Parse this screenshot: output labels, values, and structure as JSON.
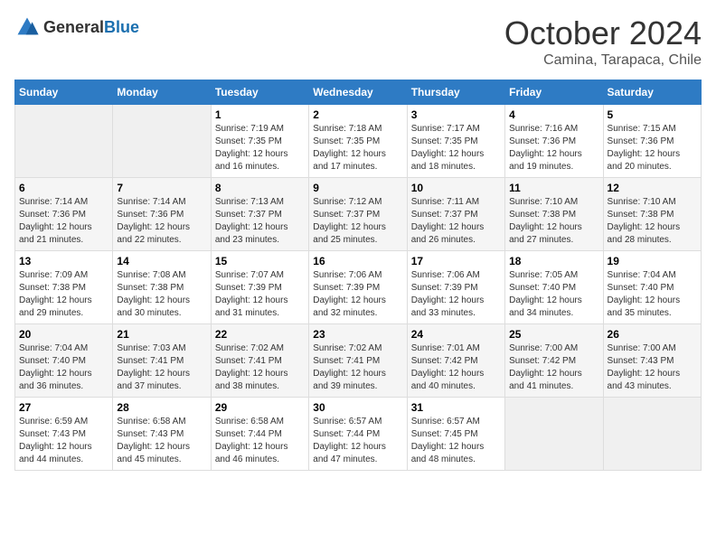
{
  "logo": {
    "general": "General",
    "blue": "Blue"
  },
  "header": {
    "month": "October 2024",
    "location": "Camina, Tarapaca, Chile"
  },
  "weekdays": [
    "Sunday",
    "Monday",
    "Tuesday",
    "Wednesday",
    "Thursday",
    "Friday",
    "Saturday"
  ],
  "weeks": [
    [
      {
        "day": null
      },
      {
        "day": null
      },
      {
        "day": "1",
        "sunrise": "Sunrise: 7:19 AM",
        "sunset": "Sunset: 7:35 PM",
        "daylight": "Daylight: 12 hours and 16 minutes."
      },
      {
        "day": "2",
        "sunrise": "Sunrise: 7:18 AM",
        "sunset": "Sunset: 7:35 PM",
        "daylight": "Daylight: 12 hours and 17 minutes."
      },
      {
        "day": "3",
        "sunrise": "Sunrise: 7:17 AM",
        "sunset": "Sunset: 7:35 PM",
        "daylight": "Daylight: 12 hours and 18 minutes."
      },
      {
        "day": "4",
        "sunrise": "Sunrise: 7:16 AM",
        "sunset": "Sunset: 7:36 PM",
        "daylight": "Daylight: 12 hours and 19 minutes."
      },
      {
        "day": "5",
        "sunrise": "Sunrise: 7:15 AM",
        "sunset": "Sunset: 7:36 PM",
        "daylight": "Daylight: 12 hours and 20 minutes."
      }
    ],
    [
      {
        "day": "6",
        "sunrise": "Sunrise: 7:14 AM",
        "sunset": "Sunset: 7:36 PM",
        "daylight": "Daylight: 12 hours and 21 minutes."
      },
      {
        "day": "7",
        "sunrise": "Sunrise: 7:14 AM",
        "sunset": "Sunset: 7:36 PM",
        "daylight": "Daylight: 12 hours and 22 minutes."
      },
      {
        "day": "8",
        "sunrise": "Sunrise: 7:13 AM",
        "sunset": "Sunset: 7:37 PM",
        "daylight": "Daylight: 12 hours and 23 minutes."
      },
      {
        "day": "9",
        "sunrise": "Sunrise: 7:12 AM",
        "sunset": "Sunset: 7:37 PM",
        "daylight": "Daylight: 12 hours and 25 minutes."
      },
      {
        "day": "10",
        "sunrise": "Sunrise: 7:11 AM",
        "sunset": "Sunset: 7:37 PM",
        "daylight": "Daylight: 12 hours and 26 minutes."
      },
      {
        "day": "11",
        "sunrise": "Sunrise: 7:10 AM",
        "sunset": "Sunset: 7:38 PM",
        "daylight": "Daylight: 12 hours and 27 minutes."
      },
      {
        "day": "12",
        "sunrise": "Sunrise: 7:10 AM",
        "sunset": "Sunset: 7:38 PM",
        "daylight": "Daylight: 12 hours and 28 minutes."
      }
    ],
    [
      {
        "day": "13",
        "sunrise": "Sunrise: 7:09 AM",
        "sunset": "Sunset: 7:38 PM",
        "daylight": "Daylight: 12 hours and 29 minutes."
      },
      {
        "day": "14",
        "sunrise": "Sunrise: 7:08 AM",
        "sunset": "Sunset: 7:38 PM",
        "daylight": "Daylight: 12 hours and 30 minutes."
      },
      {
        "day": "15",
        "sunrise": "Sunrise: 7:07 AM",
        "sunset": "Sunset: 7:39 PM",
        "daylight": "Daylight: 12 hours and 31 minutes."
      },
      {
        "day": "16",
        "sunrise": "Sunrise: 7:06 AM",
        "sunset": "Sunset: 7:39 PM",
        "daylight": "Daylight: 12 hours and 32 minutes."
      },
      {
        "day": "17",
        "sunrise": "Sunrise: 7:06 AM",
        "sunset": "Sunset: 7:39 PM",
        "daylight": "Daylight: 12 hours and 33 minutes."
      },
      {
        "day": "18",
        "sunrise": "Sunrise: 7:05 AM",
        "sunset": "Sunset: 7:40 PM",
        "daylight": "Daylight: 12 hours and 34 minutes."
      },
      {
        "day": "19",
        "sunrise": "Sunrise: 7:04 AM",
        "sunset": "Sunset: 7:40 PM",
        "daylight": "Daylight: 12 hours and 35 minutes."
      }
    ],
    [
      {
        "day": "20",
        "sunrise": "Sunrise: 7:04 AM",
        "sunset": "Sunset: 7:40 PM",
        "daylight": "Daylight: 12 hours and 36 minutes."
      },
      {
        "day": "21",
        "sunrise": "Sunrise: 7:03 AM",
        "sunset": "Sunset: 7:41 PM",
        "daylight": "Daylight: 12 hours and 37 minutes."
      },
      {
        "day": "22",
        "sunrise": "Sunrise: 7:02 AM",
        "sunset": "Sunset: 7:41 PM",
        "daylight": "Daylight: 12 hours and 38 minutes."
      },
      {
        "day": "23",
        "sunrise": "Sunrise: 7:02 AM",
        "sunset": "Sunset: 7:41 PM",
        "daylight": "Daylight: 12 hours and 39 minutes."
      },
      {
        "day": "24",
        "sunrise": "Sunrise: 7:01 AM",
        "sunset": "Sunset: 7:42 PM",
        "daylight": "Daylight: 12 hours and 40 minutes."
      },
      {
        "day": "25",
        "sunrise": "Sunrise: 7:00 AM",
        "sunset": "Sunset: 7:42 PM",
        "daylight": "Daylight: 12 hours and 41 minutes."
      },
      {
        "day": "26",
        "sunrise": "Sunrise: 7:00 AM",
        "sunset": "Sunset: 7:43 PM",
        "daylight": "Daylight: 12 hours and 43 minutes."
      }
    ],
    [
      {
        "day": "27",
        "sunrise": "Sunrise: 6:59 AM",
        "sunset": "Sunset: 7:43 PM",
        "daylight": "Daylight: 12 hours and 44 minutes."
      },
      {
        "day": "28",
        "sunrise": "Sunrise: 6:58 AM",
        "sunset": "Sunset: 7:43 PM",
        "daylight": "Daylight: 12 hours and 45 minutes."
      },
      {
        "day": "29",
        "sunrise": "Sunrise: 6:58 AM",
        "sunset": "Sunset: 7:44 PM",
        "daylight": "Daylight: 12 hours and 46 minutes."
      },
      {
        "day": "30",
        "sunrise": "Sunrise: 6:57 AM",
        "sunset": "Sunset: 7:44 PM",
        "daylight": "Daylight: 12 hours and 47 minutes."
      },
      {
        "day": "31",
        "sunrise": "Sunrise: 6:57 AM",
        "sunset": "Sunset: 7:45 PM",
        "daylight": "Daylight: 12 hours and 48 minutes."
      },
      {
        "day": null
      },
      {
        "day": null
      }
    ]
  ]
}
